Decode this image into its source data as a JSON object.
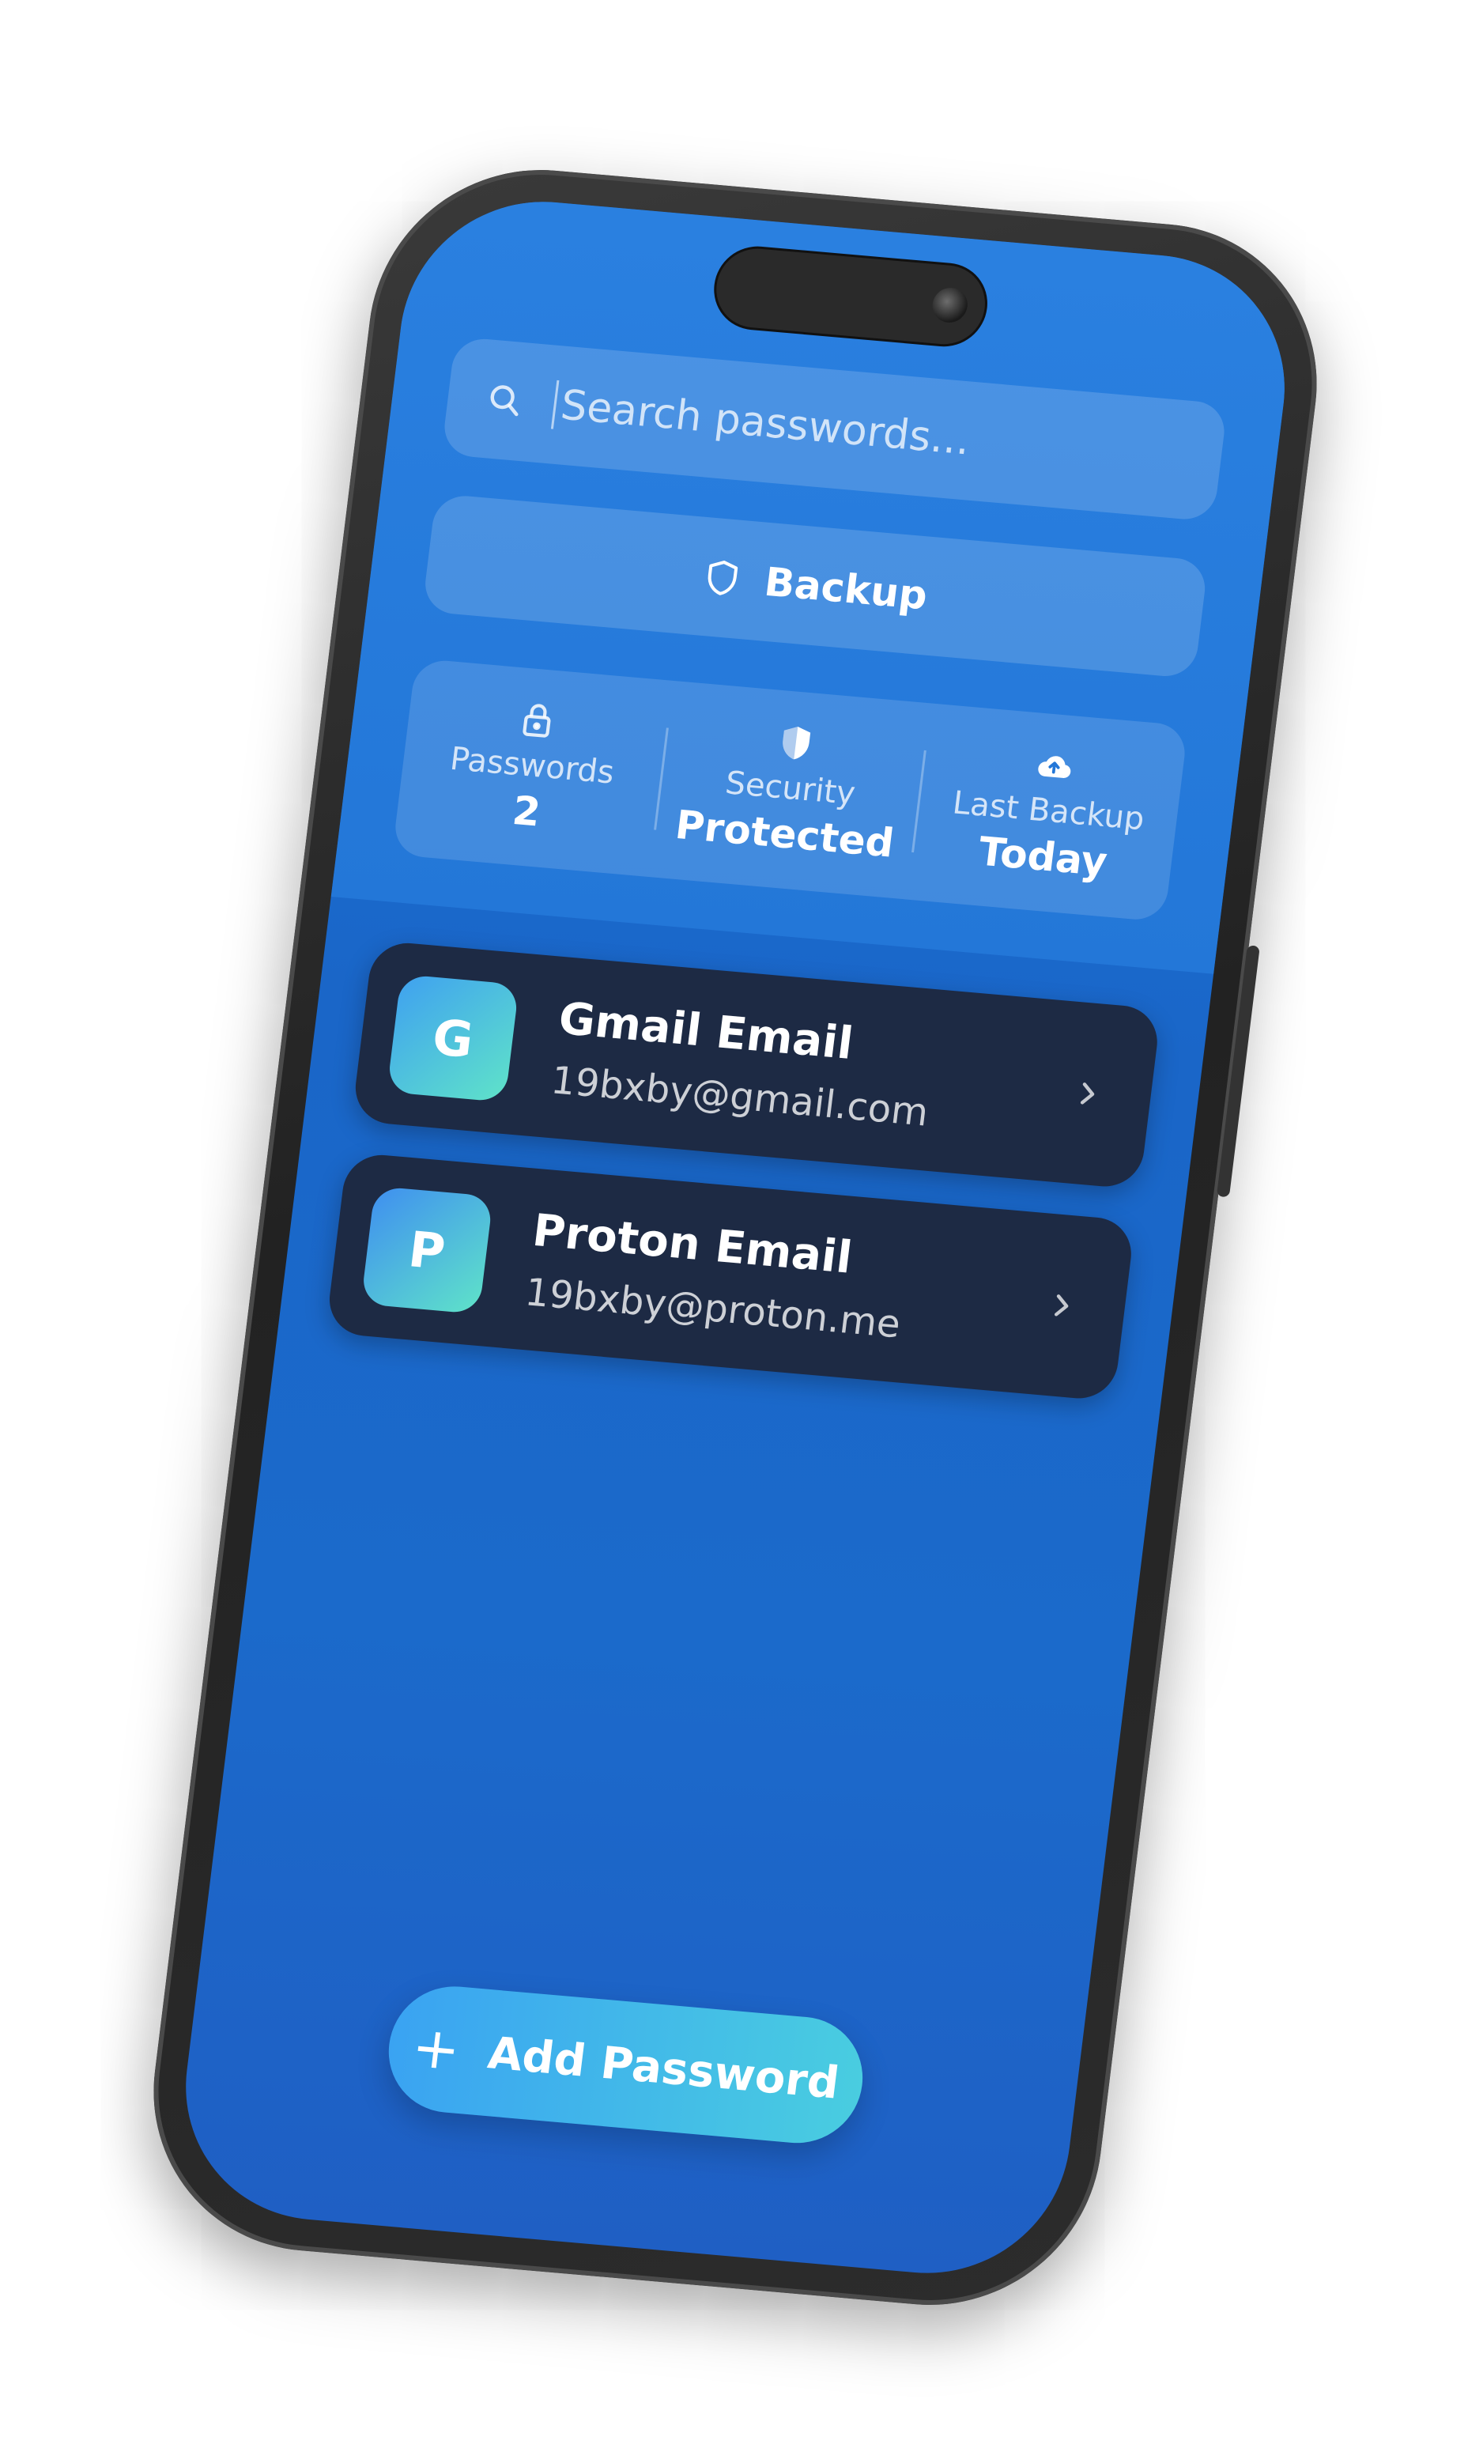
{
  "search": {
    "placeholder": "Search passwords..."
  },
  "backup_button": {
    "label": "Backup"
  },
  "stats": [
    {
      "label": "Passwords",
      "value": "2",
      "icon": "lock-icon"
    },
    {
      "label": "Security",
      "value": "Protected",
      "icon": "shield-icon"
    },
    {
      "label": "Last Backup",
      "value": "Today",
      "icon": "cloud-upload-icon"
    }
  ],
  "passwords": [
    {
      "initial": "G",
      "title": "Gmail Email",
      "email": "19bxby@gmail.com"
    },
    {
      "initial": "P",
      "title": "Proton Email",
      "email": "19bxby@proton.me"
    }
  ],
  "add_button": {
    "label": "Add Password"
  },
  "colors": {
    "screen_bg": "#1b6acb",
    "card_bg": "#1d2a44",
    "accent_start": "#3aa3f2",
    "accent_end": "#49cde0"
  }
}
